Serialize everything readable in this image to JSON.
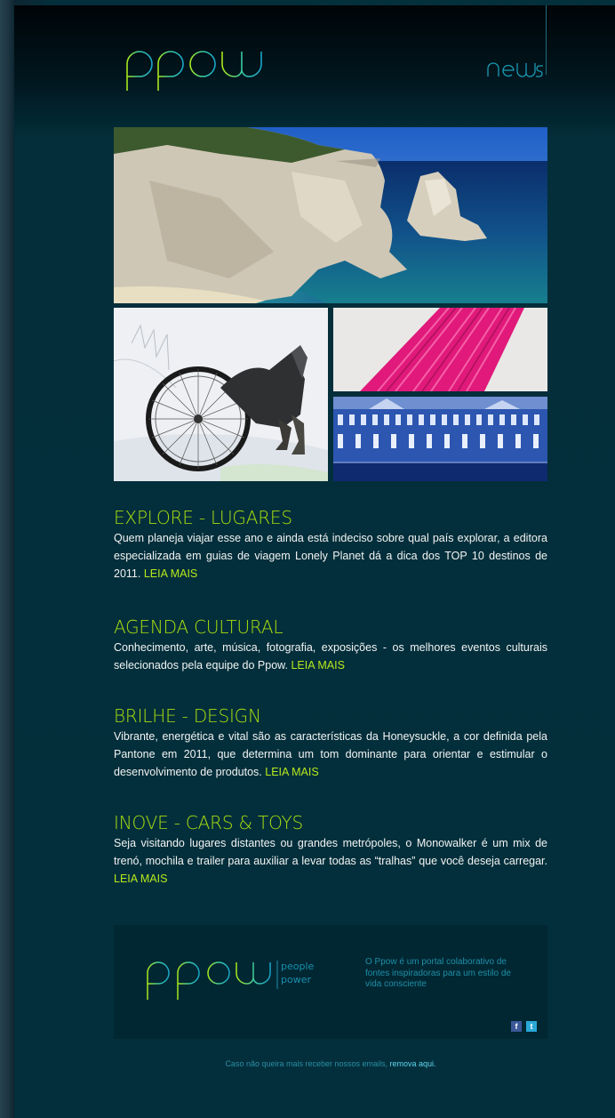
{
  "header": {
    "logo_text": "ppow",
    "nav_label": "news"
  },
  "images": {
    "hero": "cliff-coast-photo",
    "bike": "snow-bike-photo",
    "pink": "pink-stripes-photo",
    "palace": "palace-building-photo"
  },
  "sections": [
    {
      "title": "EXPLORE - LUGARES",
      "body": "Quem planeja viajar  esse ano  e ainda está indeciso sobre qual país explorar, a editora especializada em guias de viagem Lonely Planet dá a dica dos TOP 10 destinos de 2011. ",
      "more": "LEIA MAIS"
    },
    {
      "title": "AGENDA CULTURAL",
      "body": "Conhecimento, arte, música, fotografia, exposições - os melhores eventos culturais selecionados pela equipe do Ppow. ",
      "more": "LEIA MAIS"
    },
    {
      "title": "BRILHE - DESIGN",
      "body": "Vibrante, energética e vital são as características da Honeysuckle, a cor definida pela Pantone em 2011, que determina um tom dominante para orientar e estimular o desenvolvimento de produtos. ",
      "more": "LEIA MAIS"
    },
    {
      "title": "INOVE - CARS & TOYS",
      "body": "Seja visitando lugares distantes ou grandes metrópoles, o Monowalker é um mix de trenó, mochila e trailer para auxiliar a levar todas as “tralhas” que você deseja carregar. ",
      "more": "LEIA MAIS"
    }
  ],
  "footer": {
    "logo_text": "ppow",
    "tagline_top": "people",
    "tagline_bottom": "power",
    "description": "O Ppow é um portal colaborativo de fontes inspiradoras para um estilo de vida consciente",
    "facebook_glyph": "f",
    "twitter_glyph": "t",
    "unsubscribe_text": "Caso não queira mais receber nossos emails, ",
    "unsubscribe_link": "remova aqui."
  },
  "colors": {
    "accent": "#a8df10",
    "background": "#032f3c",
    "footer_text": "#1f8fa8"
  }
}
